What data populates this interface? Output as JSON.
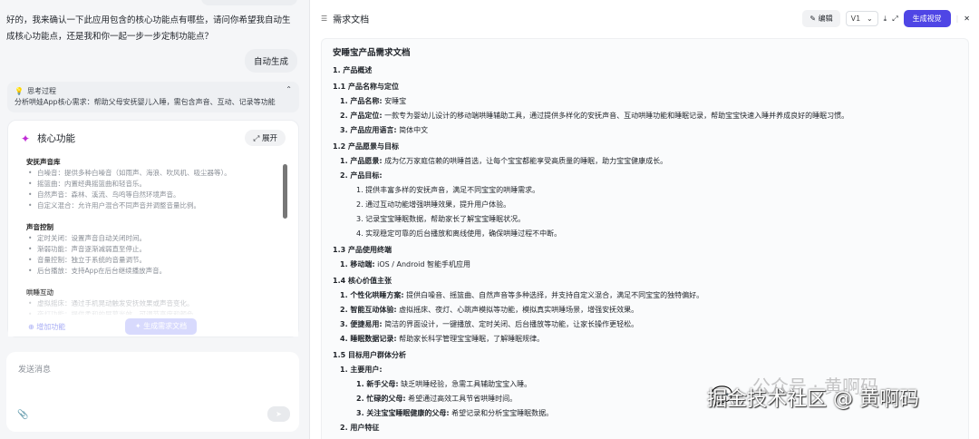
{
  "chat": {
    "assistant_message": "好的，我来确认一下此应用包含的核心功能点有哪些，请问你希望我自动生成核心功能点，还是我和你一起一步一步定制功能点？",
    "user_message": "自动生成",
    "thinking": {
      "title": "思考过程",
      "text": "分析哄娃App核心需求：帮助父母安抚婴儿入睡，需包含声音、互动、记录等功能"
    },
    "card": {
      "title": "核心功能",
      "expand_label": "展开",
      "sections": [
        {
          "title": "安抚声音库",
          "items": [
            "白噪音：提供多种白噪音（如雨声、海浪、吹风机、吸尘器等）。",
            "摇篮曲：内置经典摇篮曲和轻音乐。",
            "自然声音：森林、溪流、鸟鸣等自然环境声音。",
            "自定义混合：允许用户混合不同声音并调整音量比例。"
          ]
        },
        {
          "title": "声音控制",
          "items": [
            "定时关闭：设置声音自动关闭时间。",
            "渐弱功能：声音逐渐减弱直至停止。",
            "音量控制：独立于系统的音量调节。",
            "后台播放：支持App在后台继续播放声音。"
          ]
        },
        {
          "title": "哄睡互动",
          "items": [
            "虚拟摇床：通过手机晃动触发安抚效果或声音变化。",
            "夜灯功能：提供柔和的屏幕光效，可调节亮度和颜色。"
          ]
        }
      ],
      "add_label": "增加功能",
      "generate_label": "生成需求文档"
    },
    "input_placeholder": "发送消息"
  },
  "doc_panel": {
    "title": "需求文档",
    "edit_label": "编辑",
    "version": "V1",
    "generate_label": "生成视觉",
    "doc_title": "安睡宝产品需求文档",
    "lines": [
      {
        "k": "h",
        "t": "1. 产品概述"
      },
      {
        "k": "h",
        "t": "1.1 产品名称与定位"
      },
      {
        "k": "l1",
        "b": "1. 产品名称:",
        "t": " 安睡宝"
      },
      {
        "k": "l1",
        "b": "2. 产品定位:",
        "t": " 一款专为婴幼儿设计的移动端哄睡辅助工具，通过提供多样化的安抚声音、互动哄睡功能和睡眠记录，帮助宝宝快速入睡并养成良好的睡眠习惯。"
      },
      {
        "k": "l1",
        "b": "3. 产品应用语言:",
        "t": " 简体中文"
      },
      {
        "k": "h",
        "t": "1.2 产品愿景与目标"
      },
      {
        "k": "l1",
        "b": "1. 产品愿景:",
        "t": " 成为亿万家庭信赖的哄睡首选，让每个宝宝都能享受高质量的睡眠，助力宝宝健康成长。"
      },
      {
        "k": "l1",
        "b": "2. 产品目标:",
        "t": ""
      },
      {
        "k": "l2",
        "b": "",
        "t": "1. 提供丰富多样的安抚声音，满足不同宝宝的哄睡需求。"
      },
      {
        "k": "l2",
        "b": "",
        "t": "2. 通过互动功能增强哄睡效果，提升用户体验。"
      },
      {
        "k": "l2",
        "b": "",
        "t": "3. 记录宝宝睡眠数据，帮助家长了解宝宝睡眠状况。"
      },
      {
        "k": "l2",
        "b": "",
        "t": "4. 实现稳定可靠的后台播放和离线使用，确保哄睡过程不中断。"
      },
      {
        "k": "h",
        "t": "1.3 产品使用终端"
      },
      {
        "k": "l1",
        "b": "1. 移动端:",
        "t": " iOS / Android 智能手机应用"
      },
      {
        "k": "h",
        "t": "1.4 核心价值主张"
      },
      {
        "k": "l1",
        "b": "1. 个性化哄睡方案:",
        "t": " 提供白噪音、摇篮曲、自然声音等多种选择，并支持自定义混合，满足不同宝宝的独特偏好。"
      },
      {
        "k": "l1",
        "b": "2. 智能互动体验:",
        "t": " 虚拟摇床、夜灯、心跳声模拟等功能，模拟真实哄睡场景，增强安抚效果。"
      },
      {
        "k": "l1",
        "b": "3. 便捷易用:",
        "t": " 简洁的界面设计，一键播放、定时关闭、后台播放等功能，让家长操作更轻松。"
      },
      {
        "k": "l1",
        "b": "4. 睡眠数据记录:",
        "t": " 帮助家长科学管理宝宝睡眠，了解睡眠规律。"
      },
      {
        "k": "h",
        "t": "1.5 目标用户群体分析"
      },
      {
        "k": "l1",
        "b": "1. 主要用户:",
        "t": ""
      },
      {
        "k": "l2",
        "b": "1. 新手父母:",
        "t": " 缺乏哄睡经验，急需工具辅助宝宝入睡。"
      },
      {
        "k": "l2",
        "b": "2. 忙碌的父母:",
        "t": " 希望通过高效工具节省哄睡时间。"
      },
      {
        "k": "l2",
        "b": "3. 关注宝宝睡眠健康的父母:",
        "t": " 希望记录和分析宝宝睡眠数据。"
      },
      {
        "k": "l1",
        "b": "2. 用户特征",
        "t": ""
      }
    ]
  },
  "watermark": {
    "line1": "公众号 · 黄啊码",
    "line2": "掘金技术社区 @ 黄啊码"
  }
}
